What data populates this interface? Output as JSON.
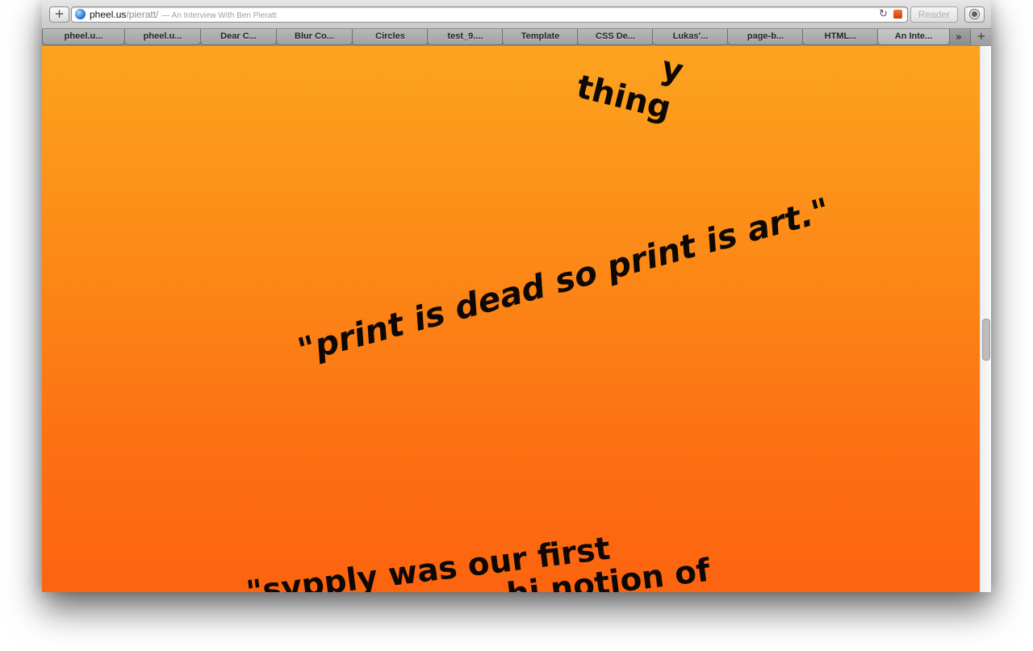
{
  "toolbar": {
    "add_label": "+",
    "url_host": "pheel.us",
    "url_path": "/pieratt/",
    "page_title": "— An Interview With Ben Pieratt",
    "reload_icon": "↻",
    "reader_label": "Reader"
  },
  "tabs": [
    {
      "label": "pheel.u..."
    },
    {
      "label": "pheel.u..."
    },
    {
      "label": "Dear C..."
    },
    {
      "label": "Blur Co..."
    },
    {
      "label": "Circles"
    },
    {
      "label": "test_9...."
    },
    {
      "label": "Template"
    },
    {
      "label": "CSS De..."
    },
    {
      "label": "Lukas'..."
    },
    {
      "label": "page-b..."
    },
    {
      "label": "HTML..."
    },
    {
      "label": "An Inte...",
      "active": true
    }
  ],
  "tab_overflow_icon": "»",
  "new_tab_icon": "+",
  "content": {
    "quote_top": [
      "y",
      "thing"
    ],
    "quote_middle": "\"print is dead so print is art.\"",
    "quote_bottom": [
      "\"svpply was our first",
      "hi notion of"
    ]
  },
  "colors": {
    "gradient_top": "#fca31f",
    "gradient_bottom": "#fc640f",
    "text": "#0e0804"
  }
}
